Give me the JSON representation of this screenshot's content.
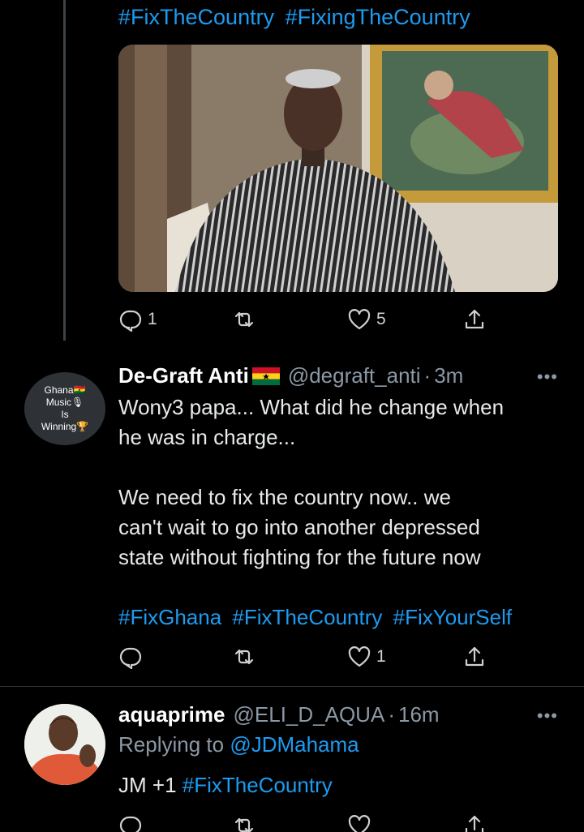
{
  "first_tweet": {
    "hashtags": [
      "#FixTheCountry",
      "#FixingTheCountry"
    ],
    "actions": {
      "reply_count": "1",
      "retweet_count": "",
      "like_count": "5"
    }
  },
  "second_tweet": {
    "avatar_text": [
      "Ghana🇬🇭",
      "Music🎙",
      "Is",
      "Winning🏆"
    ],
    "display_name": "De-Graft Anti",
    "handle": "@degraft_anti",
    "time": "3m",
    "text_lines": [
      "Wony3 papa... What did he change when",
      "he was in charge...",
      "We need to fix the country now.. we",
      "can't wait to go into another depressed",
      "state without fighting for the future now"
    ],
    "hashtags": [
      "#FixGhana",
      "#FixTheCountry",
      "#FixYourSelf"
    ],
    "actions": {
      "reply_count": "",
      "retweet_count": "",
      "like_count": "1"
    }
  },
  "third_tweet": {
    "display_name": "aquaprime",
    "handle": "@ELI_D_AQUA",
    "time": "16m",
    "replying_label": "Replying to",
    "replying_to": "@JDMahama",
    "text": "JM +1",
    "hashtag": "#FixTheCountry"
  },
  "icons": {
    "more": "more-icon",
    "reply": "reply-icon",
    "retweet": "retweet-icon",
    "like": "heart-icon",
    "share": "share-icon",
    "flag": "ghana-flag-icon"
  },
  "colors": {
    "link": "#1d9bf0",
    "muted": "#8b98a5",
    "background": "#000000"
  }
}
